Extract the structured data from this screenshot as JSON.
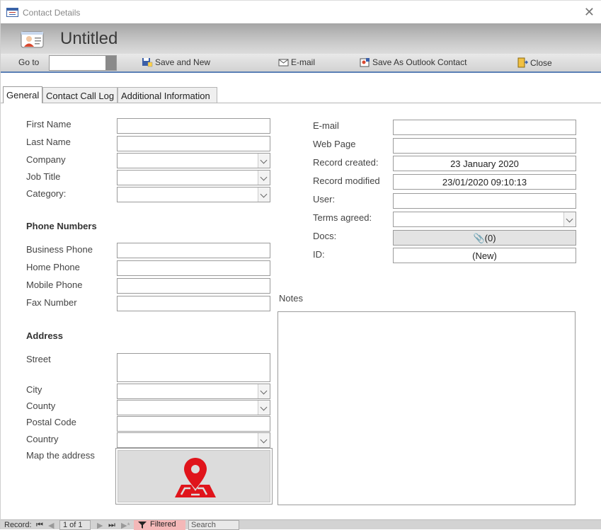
{
  "window": {
    "title": "Contact Details",
    "close_glyph": "✕"
  },
  "header": {
    "title": "Untitled",
    "icon": "contact-card-icon"
  },
  "toolbar": {
    "goto_label": "Go to",
    "goto_value": "",
    "save_new_label": "Save and New",
    "email_label": "E-mail",
    "save_outlook_label": "Save As Outlook Contact",
    "close_label": "Close"
  },
  "tabs": [
    {
      "label": "General",
      "active": true
    },
    {
      "label": "Contact Call Log",
      "active": false
    },
    {
      "label": "Additional Information",
      "active": false
    }
  ],
  "general": {
    "first_name_label": "First Name",
    "last_name_label": "Last Name",
    "company_label": "Company",
    "job_title_label": "Job Title",
    "category_label": "Category:",
    "phone_section": "Phone Numbers",
    "business_phone_label": "Business Phone",
    "home_phone_label": "Home Phone",
    "mobile_phone_label": "Mobile Phone",
    "fax_label": "Fax Number",
    "address_section": "Address",
    "street_label": "Street",
    "city_label": "City",
    "county_label": "County",
    "postal_code_label": "Postal Code",
    "country_label": "Country",
    "map_label": "Map the address",
    "email_label": "E-mail",
    "web_page_label": "Web Page",
    "record_created_label": "Record created:",
    "record_created_value": "23 January 2020",
    "record_modified_label": "Record modified",
    "record_modified_value": "23/01/2020 09:10:13",
    "user_label": "User:",
    "terms_label": "Terms agreed:",
    "docs_label": "Docs:",
    "docs_value": "(0)",
    "id_label": "ID:",
    "id_value": "(New)",
    "notes_label": "Notes"
  },
  "status": {
    "record_label": "Record:",
    "record_position": "1 of 1",
    "filter_label": "Filtered",
    "search_label": "Search"
  },
  "colors": {
    "accent": "#5a7fb5",
    "map_pin": "#e0141b",
    "filter_bg": "#f4b8b8"
  }
}
